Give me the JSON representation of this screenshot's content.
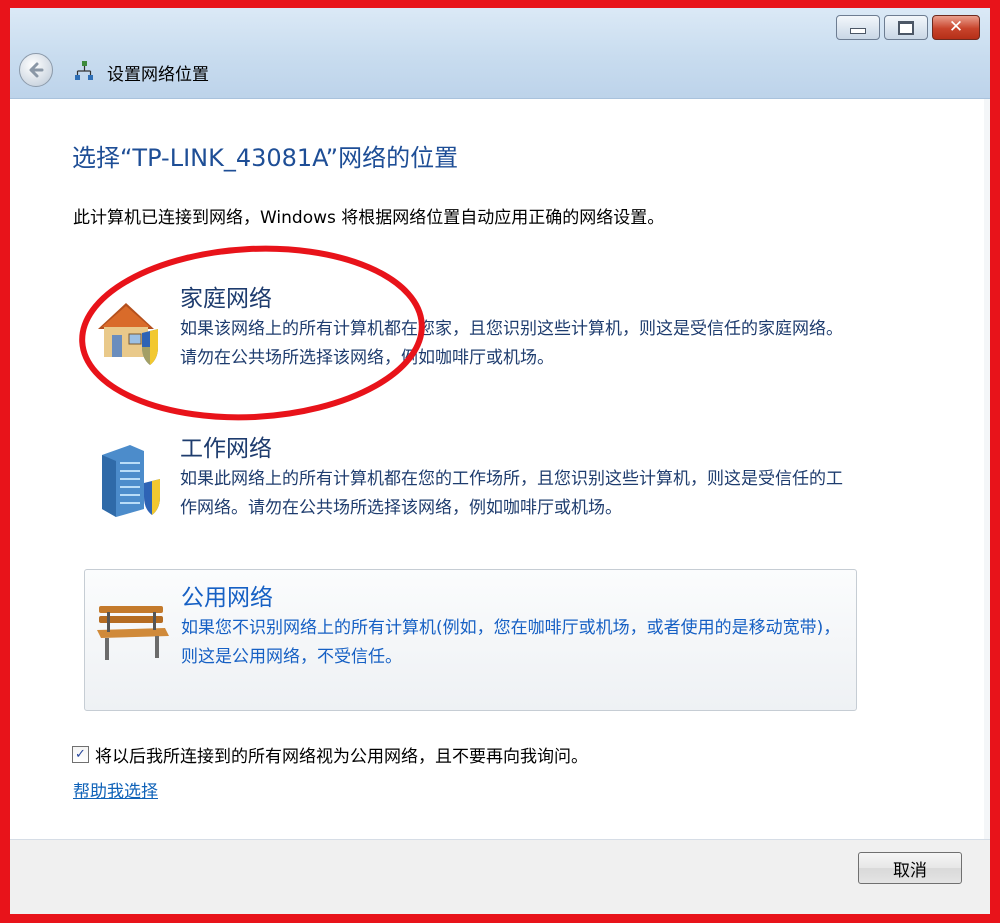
{
  "window": {
    "title": "设置网络位置"
  },
  "heading": "选择“TP-LINK_43081A”网络的位置",
  "intro": "此计算机已连接到网络，Windows 将根据网络位置自动应用正确的网络设置。",
  "options": [
    {
      "title": "家庭网络",
      "desc": "如果该网络上的所有计算机都在您家，且您识别这些计算机，则这是受信任的家庭网络。请勿在公共场所选择该网络，例如咖啡厅或机场。",
      "icon": "home-network-icon"
    },
    {
      "title": "工作网络",
      "desc": "如果此网络上的所有计算机都在您的工作场所，且您识别这些计算机，则这是受信任的工作网络。请勿在公共场所选择该网络，例如咖啡厅或机场。",
      "icon": "work-network-icon"
    },
    {
      "title": "公用网络",
      "desc": "如果您不识别网络上的所有计算机(例如，您在咖啡厅或机场，或者使用的是移动宽带)，则这是公用网络，不受信任。",
      "icon": "public-network-icon",
      "selected": true
    }
  ],
  "checkbox": {
    "label": "将以后我所连接到的所有网络视为公用网络，且不要再向我询问。",
    "checked": true,
    "mark": "✓"
  },
  "help_link": "帮助我选择",
  "footer": {
    "cancel_label": "取消"
  },
  "colors": {
    "heading": "#1e4e96",
    "selected_text": "#1660c4",
    "annotation": "#e8131a"
  }
}
